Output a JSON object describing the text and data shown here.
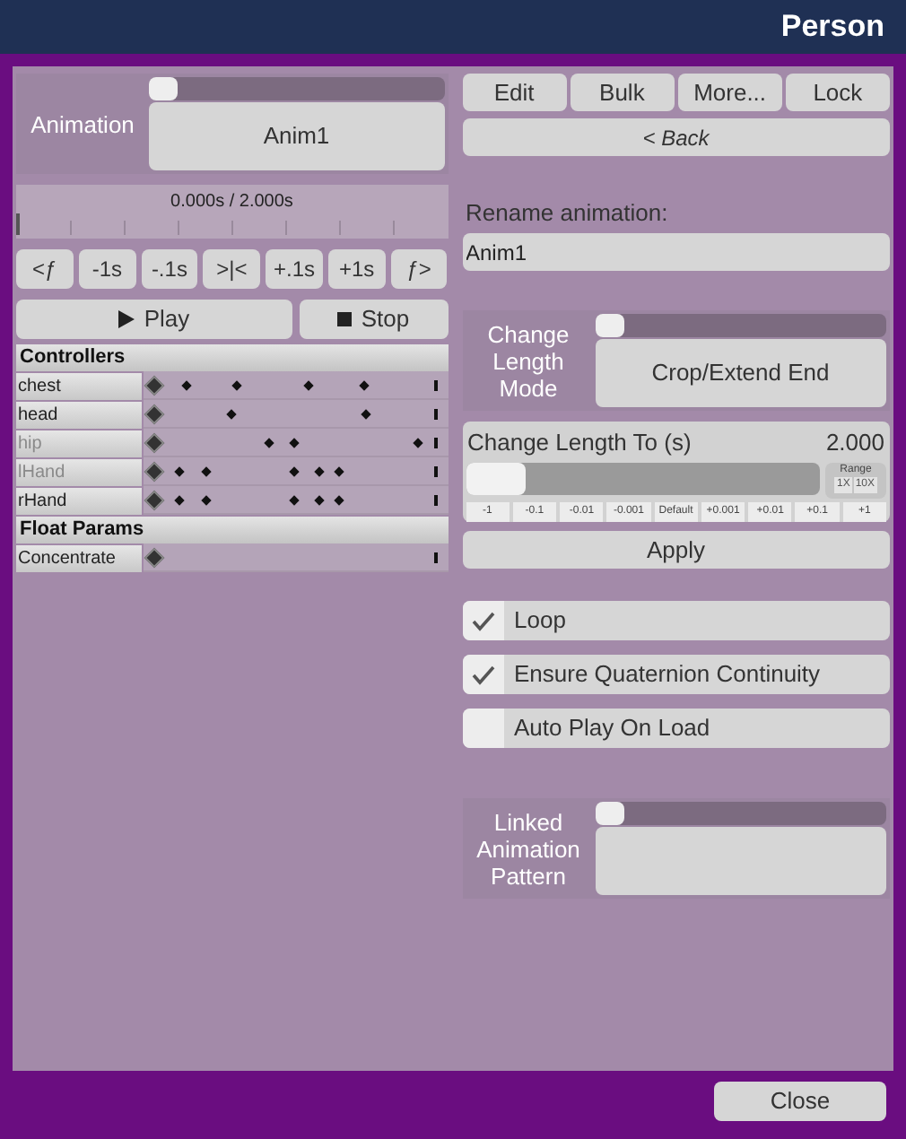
{
  "window": {
    "title": "Person"
  },
  "animation": {
    "label": "Animation",
    "value": "Anim1",
    "level": 0
  },
  "scrubber": {
    "time": "0.000s / 2.000s",
    "level": 0
  },
  "step_buttons": [
    "<ƒ",
    "-1s",
    "-.1s",
    ">|<",
    "+.1s",
    "+1s",
    "ƒ>"
  ],
  "play_buttons": [
    {
      "kind": "play",
      "label": "Play"
    },
    {
      "kind": "stop",
      "label": "Stop"
    }
  ],
  "sections": [
    {
      "title": "Controllers",
      "rows": [
        {
          "name": "chest",
          "dimmed": false,
          "keys": [
            {
              "level": 0.11
            },
            {
              "level": 0.285
            },
            {
              "level": 0.544
            },
            {
              "level": 0.74
            }
          ]
        },
        {
          "name": "head",
          "dimmed": false,
          "keys": [
            {
              "level": 0.27
            },
            {
              "level": 0.75
            }
          ]
        },
        {
          "name": "hip",
          "dimmed": true,
          "keys": [
            {
              "level": 0.405
            },
            {
              "level": 0.49
            },
            {
              "level": 0.93
            }
          ]
        },
        {
          "name": "lHand",
          "dimmed": true,
          "keys": [
            {
              "level": 0.08
            },
            {
              "level": 0.18
            },
            {
              "level": 0.49
            },
            {
              "level": 0.58
            },
            {
              "level": 0.65
            }
          ]
        },
        {
          "name": "rHand",
          "dimmed": false,
          "keys": [
            {
              "level": 0.08
            },
            {
              "level": 0.18
            },
            {
              "level": 0.49
            },
            {
              "level": 0.58
            },
            {
              "level": 0.65
            }
          ]
        }
      ]
    },
    {
      "title": "Float Params",
      "rows": [
        {
          "name": "Concentrate",
          "dimmed": false,
          "keys": []
        }
      ]
    }
  ],
  "top_buttons": [
    "Edit",
    "Bulk",
    "More...",
    "Lock"
  ],
  "back_button": "< Back",
  "rename": {
    "label": "Rename animation:",
    "value": "Anim1"
  },
  "length_mode": {
    "label": "Change Length Mode",
    "value": "Crop/Extend End",
    "level": 0
  },
  "length_to": {
    "label": "Change Length To (s)",
    "value": "2.000",
    "level": 0.17,
    "range_label": "Range",
    "range_buttons": [
      "1X",
      "10X"
    ],
    "steps": [
      "-1",
      "-0.1",
      "-0.01",
      "-0.001",
      "Default",
      "+0.001",
      "+0.01",
      "+0.1",
      "+1"
    ]
  },
  "apply_button": "Apply",
  "toggles": [
    {
      "label": "Loop",
      "checked": true
    },
    {
      "label": "Ensure Quaternion Continuity",
      "checked": true
    },
    {
      "label": "Auto Play On Load",
      "checked": false
    }
  ],
  "linked": {
    "label": "Linked Animation Pattern",
    "level": 0
  },
  "close_button": "Close"
}
